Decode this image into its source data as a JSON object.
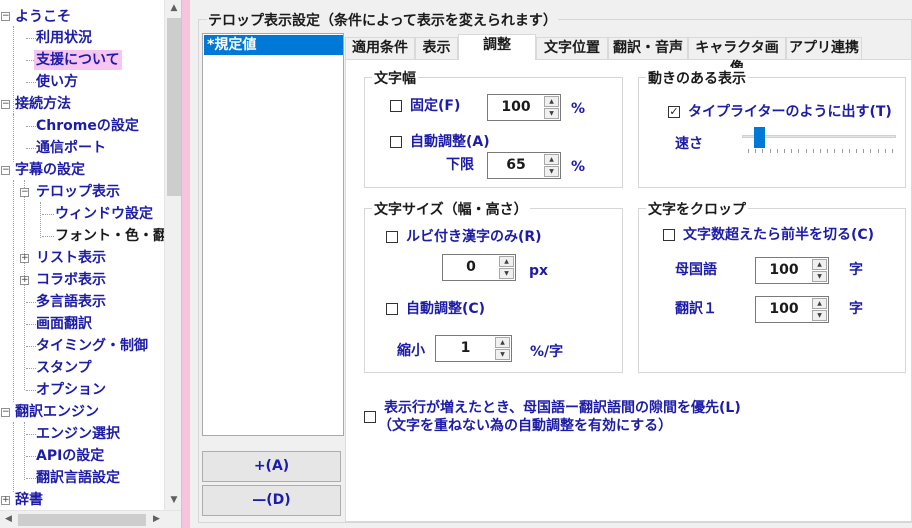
{
  "tree": {
    "items": [
      {
        "label": "ようこそ",
        "expander": "−"
      },
      {
        "label": "利用状況"
      },
      {
        "label": "支援について"
      },
      {
        "label": "使い方"
      },
      {
        "label": "接続方法",
        "expander": "−"
      },
      {
        "label": "Chromeの設定"
      },
      {
        "label": "通信ポート"
      },
      {
        "label": "字幕の設定",
        "expander": "−"
      },
      {
        "label": "テロップ表示",
        "expander": "−"
      },
      {
        "label": "ウィンドウ設定"
      },
      {
        "label": "フォント・色・翻訳"
      },
      {
        "label": "リスト表示",
        "expander": "+"
      },
      {
        "label": "コラボ表示",
        "expander": "+"
      },
      {
        "label": "多言語表示"
      },
      {
        "label": "画面翻訳"
      },
      {
        "label": "タイミング・制御"
      },
      {
        "label": "スタンプ"
      },
      {
        "label": "オプション"
      },
      {
        "label": "翻訳エンジン",
        "expander": "−"
      },
      {
        "label": "エンジン選択"
      },
      {
        "label": "APIの設定"
      },
      {
        "label": "翻訳言語設定"
      },
      {
        "label": "辞書",
        "expander": "+"
      }
    ],
    "selected": "支援について",
    "current": "フォント・色・翻訳"
  },
  "group_title": "テロップ表示設定（条件によって表示を変えられます）",
  "presets": [
    "*規定値"
  ],
  "buttons": {
    "add": "+(A)",
    "delete": "—(D)"
  },
  "tabs": [
    "適用条件",
    "表示",
    "調整",
    "文字位置",
    "翻訳・音声",
    "キャラクタ画像",
    "アプリ連携"
  ],
  "active_tab": "調整",
  "char_width": {
    "title": "文字幅",
    "fixed_label": "固定(F)",
    "fixed_checked": false,
    "fixed_value": "100",
    "fixed_unit": "%",
    "auto_label": "自動調整(A)",
    "auto_checked": false,
    "lower_label": "下限",
    "lower_value": "65",
    "lower_unit": "%"
  },
  "motion": {
    "title": "動きのある表示",
    "typewriter_label": "タイプライターのように出す(T)",
    "typewriter_checked": true,
    "speed_label": "速さ",
    "speed_position": 0.08
  },
  "char_size": {
    "title": "文字サイズ（幅・高さ）",
    "ruby_label": "ルビ付き漢字のみ(R)",
    "ruby_checked": false,
    "ruby_value": "0",
    "ruby_unit": "px",
    "auto_label": "自動調整(C)",
    "auto_checked": false,
    "shrink_label": "縮小",
    "shrink_value": "1",
    "shrink_unit": "%/字"
  },
  "crop": {
    "title": "文字をクロップ",
    "cut_label": "文字数超えたら前半を切る(C)",
    "cut_checked": false,
    "native_label": "母国語",
    "native_value": "100",
    "native_unit": "字",
    "trans_label": "翻訳１",
    "trans_value": "100",
    "trans_unit": "字"
  },
  "priority": {
    "line1": "表示行が増えたとき、母国語ー翻訳語間の隙間を優先(L)",
    "line2": "（文字を重ねない為の自動調整を有効にする）",
    "checked": false
  },
  "colors": {
    "accent": "#0078d7",
    "label_blue": "#1c1ca8",
    "selection_pink": "#f8c4f0",
    "side_pink": "#f6c4dc"
  }
}
